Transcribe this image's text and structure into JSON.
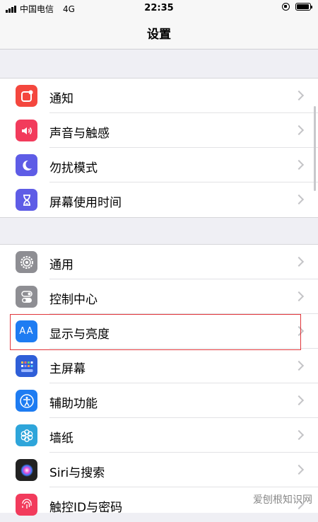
{
  "status_bar": {
    "carrier": "中国电信",
    "network": "4G",
    "time": "22:35"
  },
  "nav": {
    "title": "设置"
  },
  "groups": [
    {
      "items": [
        {
          "label": "通知",
          "icon": "notifications-icon",
          "color": "#f4473e"
        },
        {
          "label": "声音与触感",
          "icon": "sounds-icon",
          "color": "#f23b5c"
        },
        {
          "label": "勿扰模式",
          "icon": "moon-icon",
          "color": "#5e5ce6"
        },
        {
          "label": "屏幕使用时间",
          "icon": "hourglass-icon",
          "color": "#5e5ce6"
        }
      ]
    },
    {
      "items": [
        {
          "label": "通用",
          "icon": "gear-icon",
          "color": "#8e8e93"
        },
        {
          "label": "控制中心",
          "icon": "toggles-icon",
          "color": "#8e8e93"
        },
        {
          "label": "显示与亮度",
          "icon": "display-brightness-icon",
          "color": "#1e7cf2",
          "icon_text": "AA"
        },
        {
          "label": "主屏幕",
          "icon": "home-screen-icon",
          "color": "#2f5fd8"
        },
        {
          "label": "辅助功能",
          "icon": "accessibility-icon",
          "color": "#1e7cf2"
        },
        {
          "label": "墙纸",
          "icon": "wallpaper-icon",
          "color": "#2ea5da"
        },
        {
          "label": "Siri与搜索",
          "icon": "siri-icon",
          "color": "#222222"
        },
        {
          "label": "触控ID与密码",
          "icon": "fingerprint-icon",
          "color": "#f23b5c"
        }
      ]
    }
  ],
  "watermark": "爱刨根知识网"
}
